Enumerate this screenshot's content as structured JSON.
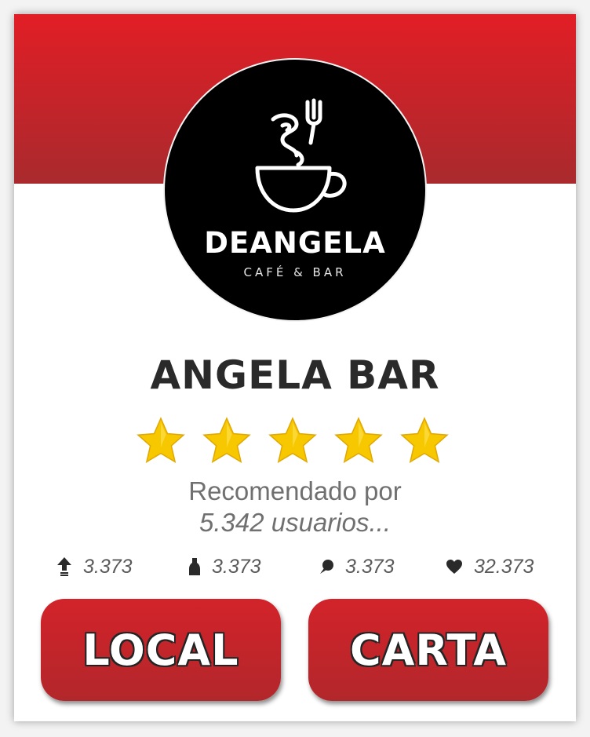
{
  "header": {
    "banner_color": "#c82329"
  },
  "logo": {
    "icon": "coffee-cup-icon",
    "name": "DEANGELA",
    "subtitle": "CAFÉ & BAR"
  },
  "venue": {
    "name": "ANGELA BAR",
    "rating": 5,
    "rating_max": 5,
    "star_icon": "star-icon",
    "star_color": "#f7c700"
  },
  "recommendation": {
    "line1": "Recomendado por",
    "line2": "5.342 usuarios..."
  },
  "stats": [
    {
      "icon": "upvote-arrow-icon",
      "value": "3.373"
    },
    {
      "icon": "bottle-icon",
      "value": "3.373"
    },
    {
      "icon": "comment-icon",
      "value": "3.373"
    },
    {
      "icon": "heart-icon",
      "value": "32.373"
    }
  ],
  "buttons": {
    "local_label": "LOCAL",
    "carta_label": "CARTA",
    "color": "#c0252a"
  }
}
